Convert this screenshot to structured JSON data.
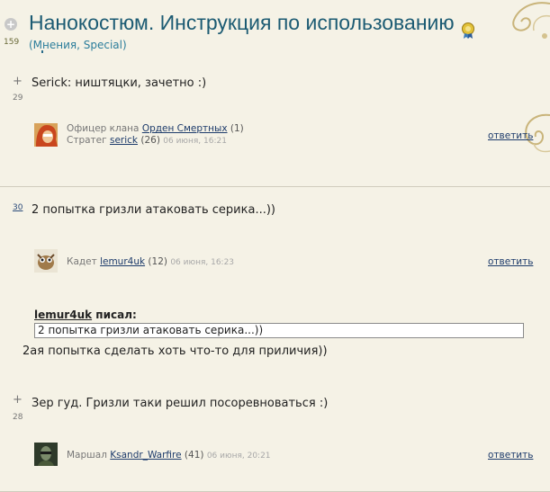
{
  "topic": {
    "score": "159",
    "title": "Нанокостюм. Инструкция по использованию",
    "subtitle": "(Мнения, Special)"
  },
  "posts": [
    {
      "vote": "29",
      "text": "Serick: ништяцки, зачетно :)",
      "author_line1_prefix": "Офицер клана",
      "clan": "Орден Смертных",
      "clan_count": "(1)",
      "rank": "Стратег",
      "author": "serick",
      "author_count": "(26)",
      "date": "06 июня, 16:21",
      "reply": "ответить"
    },
    {
      "vote": "30",
      "text": "2 попытка гризли атаковать серика...))",
      "rank": "Кадет",
      "author": "lemur4uk",
      "author_count": "(12)",
      "date": "06 июня, 16:23",
      "reply": "ответить"
    },
    {
      "quote_author": "lemur4uk",
      "quote_wrote": "писал:",
      "quote_text": "2 попытка гризли атаковать серика...))",
      "text": "2ая попытка сделать хоть что-то для приличия))"
    },
    {
      "vote": "28",
      "text": "Зер гуд. Гризли таки решил посоревноваться :)",
      "rank": "Маршал",
      "author": "Ksandr_Warfire",
      "author_count": "(41)",
      "date": "06 июня, 20:21",
      "reply": "ответить"
    }
  ],
  "vote_plus": "+",
  "icons": {
    "collapse": "circle-plus-icon",
    "medal": "medal-icon"
  },
  "colors": {
    "background": "#f5f2e6",
    "title": "#1c5b73",
    "link": "#1d3b6b"
  }
}
